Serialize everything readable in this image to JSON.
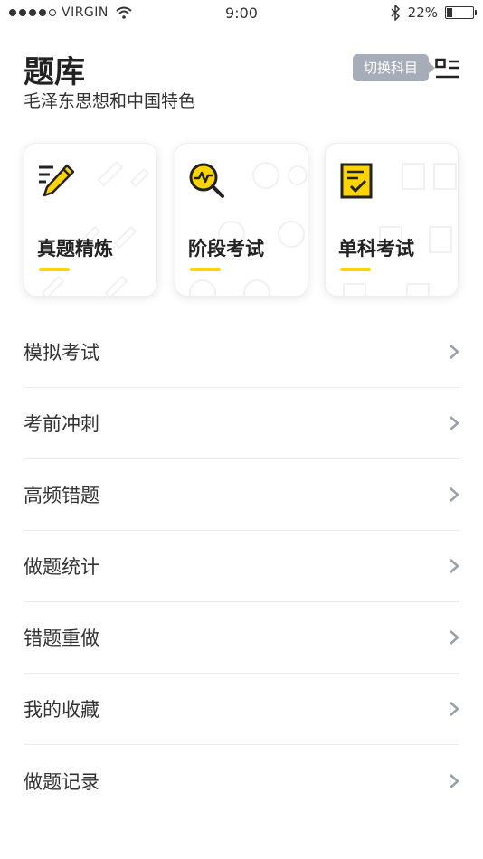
{
  "status_bar": {
    "carrier": "VIRGIN",
    "time": "9:00",
    "battery_percent": "22%",
    "battery_level": 0.22,
    "signal_dots_filled": 4,
    "signal_dots_total": 5
  },
  "header": {
    "title": "题库",
    "subtitle": "毛泽东思想和中国特色",
    "switch_tip": "切换科目",
    "list_icon": "list-icon"
  },
  "cards": [
    {
      "label": "真题精炼",
      "icon": "pencil-icon"
    },
    {
      "label": "阶段考试",
      "icon": "magnifier-chart-icon"
    },
    {
      "label": "单科考试",
      "icon": "checklist-icon"
    }
  ],
  "menu": [
    {
      "label": "模拟考试"
    },
    {
      "label": "考前冲刺"
    },
    {
      "label": "高频错题"
    },
    {
      "label": "做题统计"
    },
    {
      "label": "错题重做"
    },
    {
      "label": "我的收藏"
    },
    {
      "label": "做题记录"
    }
  ],
  "colors": {
    "accent_yellow": "#ffd400",
    "tooltip_gray": "#a7adb8",
    "text_dark": "#222222"
  }
}
